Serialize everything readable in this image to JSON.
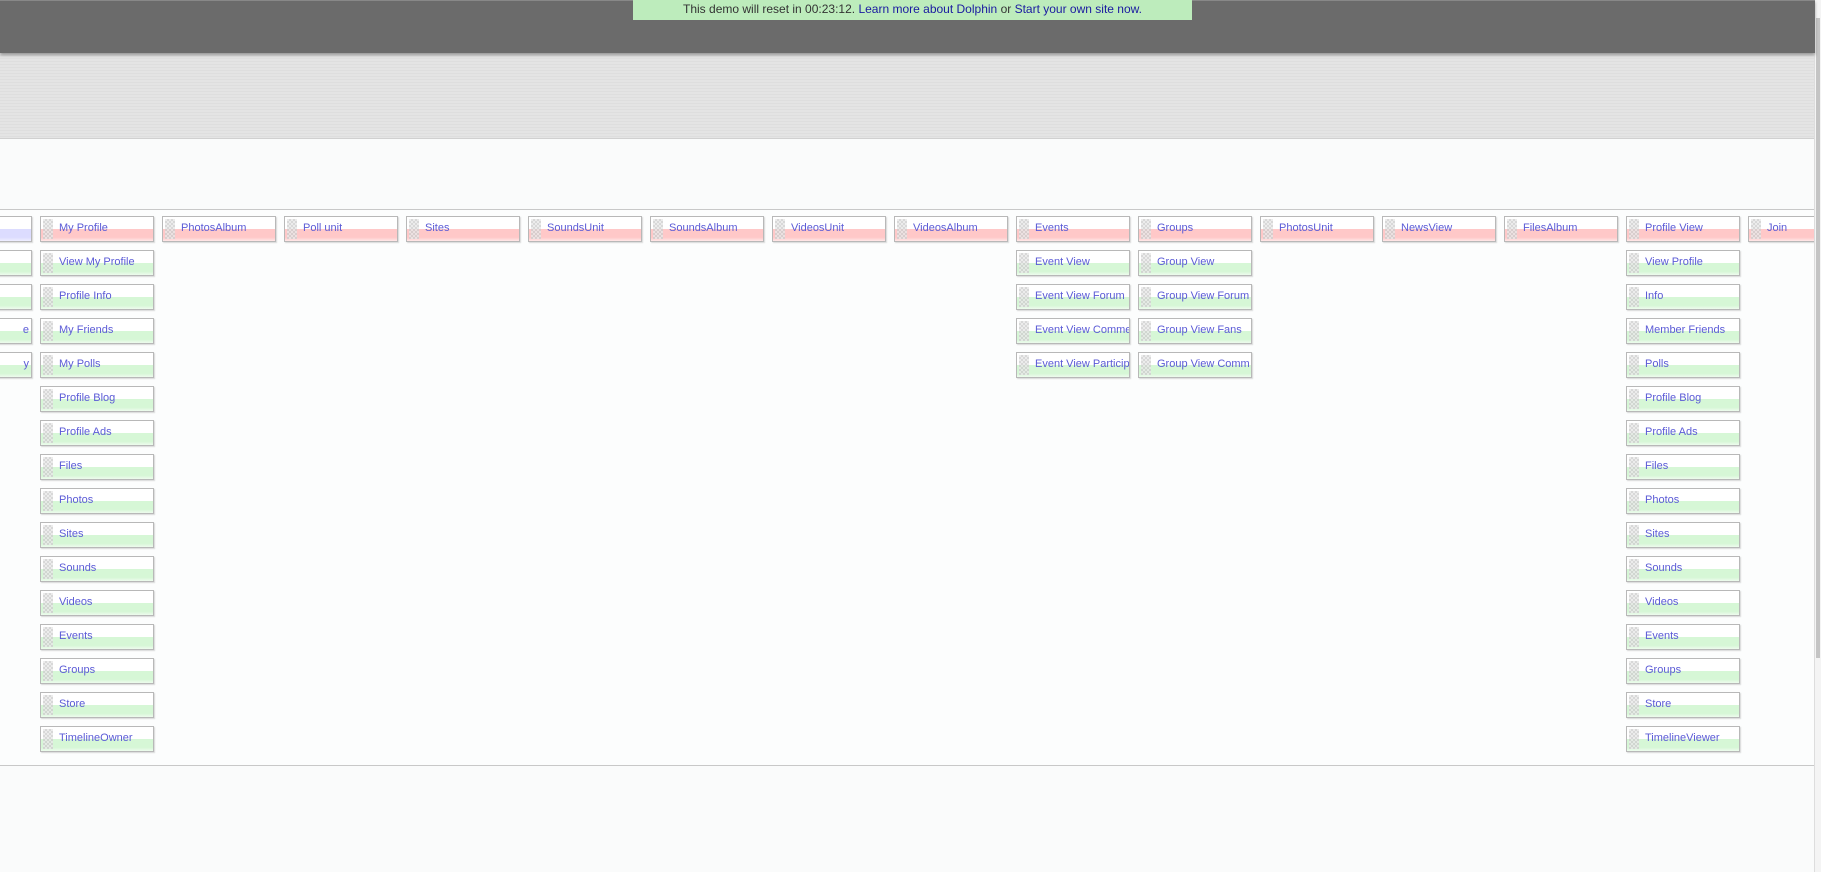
{
  "banner": {
    "text": "This demo will reset in 00:23:12.",
    "link1": "Learn more about Dolphin",
    "or": "or",
    "link2": "Start your own site now."
  },
  "colors": {
    "top_item": "#ffc8c8",
    "sub_item": "#d6f7d6",
    "partial_top_item": "#dcdcff",
    "label": "#5b5bd6"
  },
  "columns": [
    {
      "items": [
        "",
        "",
        "",
        "e",
        "y"
      ],
      "partial": true
    },
    {
      "items": [
        "My Profile",
        "View My Profile",
        "Profile Info",
        "My Friends",
        "My Polls",
        "Profile Blog",
        "Profile Ads",
        "Files",
        "Photos",
        "Sites",
        "Sounds",
        "Videos",
        "Events",
        "Groups",
        "Store",
        "TimelineOwner"
      ]
    },
    {
      "items": [
        "PhotosAlbum"
      ]
    },
    {
      "items": [
        "Poll unit"
      ]
    },
    {
      "items": [
        "Sites"
      ]
    },
    {
      "items": [
        "SoundsUnit"
      ]
    },
    {
      "items": [
        "SoundsAlbum"
      ]
    },
    {
      "items": [
        "VideosUnit"
      ]
    },
    {
      "items": [
        "VideosAlbum"
      ]
    },
    {
      "items": [
        "Events",
        "Event View",
        "Event View Forum",
        "Event View Comme",
        "Event View Particip"
      ]
    },
    {
      "items": [
        "Groups",
        "Group View",
        "Group View Forum",
        "Group View Fans",
        "Group View Comm"
      ]
    },
    {
      "items": [
        "PhotosUnit"
      ]
    },
    {
      "items": [
        "NewsView"
      ]
    },
    {
      "items": [
        "FilesAlbum"
      ]
    },
    {
      "items": [
        "Profile View",
        "View Profile",
        "Info",
        "Member Friends",
        "Polls",
        "Profile Blog",
        "Profile Ads",
        "Files",
        "Photos",
        "Sites",
        "Sounds",
        "Videos",
        "Events",
        "Groups",
        "Store",
        "TimelineViewer"
      ]
    },
    {
      "items": [
        "Join"
      ]
    }
  ]
}
